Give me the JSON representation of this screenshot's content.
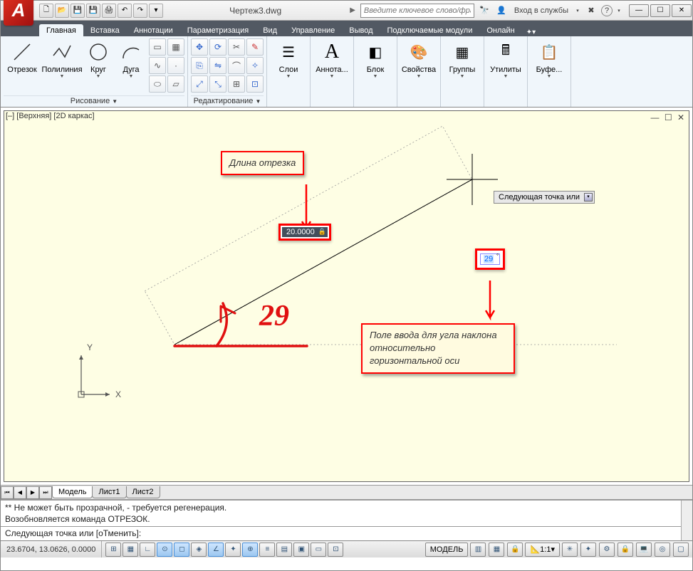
{
  "title": "Чертеж3.dwg",
  "search_placeholder": "Введите ключевое слово/фразу",
  "signin_label": "Вход в службы",
  "tabs": {
    "home": "Главная",
    "insert": "Вставка",
    "annotate": "Аннотации",
    "param": "Параметризация",
    "view": "Вид",
    "manage": "Управление",
    "output": "Вывод",
    "plugins": "Подключаемые модули",
    "online": "Онлайн"
  },
  "ribbon": {
    "draw_panel": "Рисование",
    "edit_panel": "Редактирование",
    "line": "Отрезок",
    "polyline": "Полилиния",
    "circle": "Круг",
    "arc": "Дуга",
    "layers": "Слои",
    "annot": "Аннота...",
    "block": "Блок",
    "props": "Свойства",
    "groups": "Группы",
    "utils": "Утилиты",
    "clip": "Буфе..."
  },
  "viewport_label": "[–] [Верхняя] [2D каркас]",
  "dynamic_length_value": "20.0000",
  "dynamic_angle_value": "29",
  "tooltip_next_point": "Следующая точка или",
  "callout_length": "Длина отрезка",
  "callout_angle": "Поле ввода для угла наклона относительно горизонтальной оси",
  "hand_annotation": "29",
  "ucs": {
    "x": "X",
    "y": "Y"
  },
  "sheet_tabs": {
    "model": "Модель",
    "sheet1": "Лист1",
    "sheet2": "Лист2"
  },
  "cmd_history_1": "** Не может быть прозрачной, - требуется регенерация.",
  "cmd_history_2": "Возобновляется команда ОТРЕЗОК.",
  "cmd_prompt": "Следующая точка или [оТменить]:",
  "status": {
    "coords": "23.6704, 13.0626, 0.0000",
    "model": "МОДЕЛЬ",
    "scale": "1:1"
  }
}
